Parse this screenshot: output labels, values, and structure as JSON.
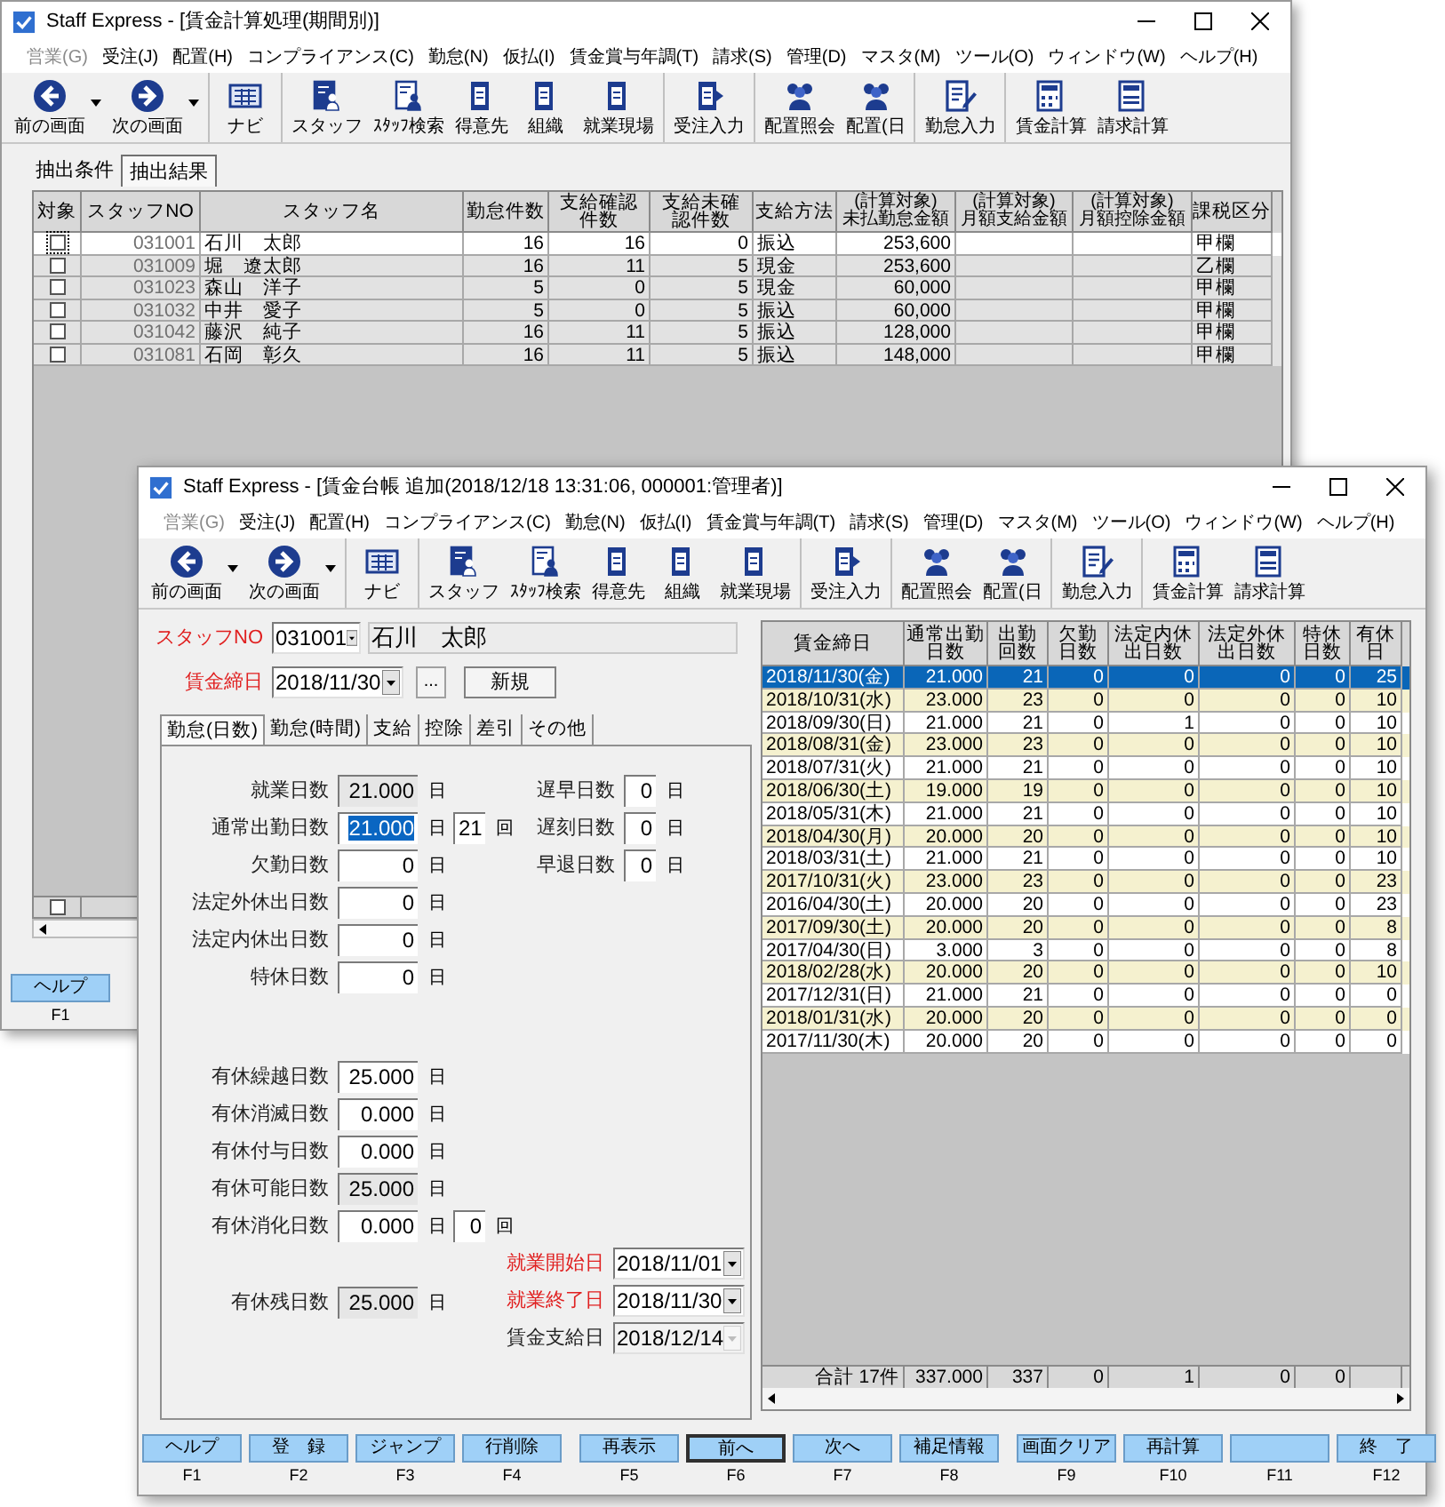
{
  "back_window": {
    "title": "Staff Express - [賃金計算処理(期間別)]",
    "menu": [
      {
        "label": "営業(G)",
        "disabled": true
      },
      {
        "label": "受注(J)",
        "disabled": false
      },
      {
        "label": "配置(H)",
        "disabled": false
      },
      {
        "label": "コンプライアンス(C)",
        "disabled": false
      },
      {
        "label": "勤怠(N)",
        "disabled": false
      },
      {
        "label": "仮払(I)",
        "disabled": false
      },
      {
        "label": "賃金賞与年調(T)",
        "disabled": false
      },
      {
        "label": "請求(S)",
        "disabled": false
      },
      {
        "label": "管理(D)",
        "disabled": false
      },
      {
        "label": "マスタ(M)",
        "disabled": false
      },
      {
        "label": "ツール(O)",
        "disabled": false
      },
      {
        "label": "ウィンドウ(W)",
        "disabled": false
      },
      {
        "label": "ヘルプ(H)",
        "disabled": false
      }
    ],
    "toolbar": [
      [
        {
          "label": "前の画面",
          "kind": "back",
          "dropdown": true
        },
        {
          "label": "次の画面",
          "kind": "forward",
          "dropdown": true
        }
      ],
      [
        {
          "label": "ナビ",
          "kind": "panel",
          "dropdown": false
        }
      ],
      [
        {
          "label": "スタッフ",
          "kind": "staff",
          "dropdown": false
        },
        {
          "label": "ｽﾀｯﾌ検索",
          "kind": "search",
          "dropdown": false
        },
        {
          "label": "得意先",
          "kind": "doc",
          "dropdown": false
        },
        {
          "label": "組織",
          "kind": "doc",
          "dropdown": false
        },
        {
          "label": "就業現場",
          "kind": "doc",
          "dropdown": false
        }
      ],
      [
        {
          "label": "受注入力",
          "kind": "doc-arrow",
          "dropdown": false
        }
      ],
      [
        {
          "label": "配置照会",
          "kind": "people",
          "dropdown": false
        },
        {
          "label": "配置(日",
          "kind": "people",
          "dropdown": false
        }
      ],
      [
        {
          "label": "勤怠入力",
          "kind": "pen",
          "dropdown": false
        }
      ],
      [
        {
          "label": "賃金計算",
          "kind": "calc",
          "dropdown": false
        },
        {
          "label": "請求計算",
          "kind": "calc-doc",
          "dropdown": false
        }
      ]
    ],
    "tabs": [
      {
        "label": "抽出条件",
        "selected": false
      },
      {
        "label": "抽出結果",
        "selected": true
      }
    ],
    "table": {
      "columns": [
        "対象",
        "スタッフNO",
        "スタッフ名",
        "勤怠件数",
        "支給確認件数",
        "支給未確認件数",
        "支給方法",
        "(計算対象)未払勤怠金額",
        "(計算対象)月額支給金額",
        "(計算対象)月額控除金額",
        "課税区分"
      ],
      "rows": [
        {
          "checked": false,
          "selected": true,
          "cells": [
            "",
            "031001",
            "石川　太郎",
            "16",
            "16",
            "0",
            "振込",
            "253,600",
            "",
            "",
            "甲欄"
          ]
        },
        {
          "checked": false,
          "selected": false,
          "cells": [
            "",
            "031009",
            "堀　遼太郎",
            "16",
            "11",
            "5",
            "現金",
            "253,600",
            "",
            "",
            "乙欄"
          ]
        },
        {
          "checked": false,
          "selected": false,
          "cells": [
            "",
            "031023",
            "森山　洋子",
            "5",
            "0",
            "5",
            "現金",
            "60,000",
            "",
            "",
            "甲欄"
          ]
        },
        {
          "checked": false,
          "selected": false,
          "cells": [
            "",
            "031032",
            "中井　愛子",
            "5",
            "0",
            "5",
            "振込",
            "60,000",
            "",
            "",
            "甲欄"
          ]
        },
        {
          "checked": false,
          "selected": false,
          "cells": [
            "",
            "031042",
            "藤沢　純子",
            "16",
            "11",
            "5",
            "振込",
            "128,000",
            "",
            "",
            "甲欄"
          ]
        },
        {
          "checked": false,
          "selected": false,
          "cells": [
            "",
            "031081",
            "石岡　彰久",
            "16",
            "11",
            "5",
            "振込",
            "148,000",
            "",
            "",
            "甲欄"
          ]
        }
      ],
      "new_row": {
        "checked": false
      }
    },
    "function_keys": [
      {
        "label": "ヘルプ",
        "key": "F1"
      }
    ]
  },
  "front_window": {
    "title": "Staff Express - [賃金台帳 追加(2018/12/18 13:31:06, 000001:管理者)]",
    "menu": [
      {
        "label": "営業(G)",
        "disabled": true
      },
      {
        "label": "受注(J)",
        "disabled": false
      },
      {
        "label": "配置(H)",
        "disabled": false
      },
      {
        "label": "コンプライアンス(C)",
        "disabled": false
      },
      {
        "label": "勤怠(N)",
        "disabled": false
      },
      {
        "label": "仮払(I)",
        "disabled": false
      },
      {
        "label": "賃金賞与年調(T)",
        "disabled": false
      },
      {
        "label": "請求(S)",
        "disabled": false
      },
      {
        "label": "管理(D)",
        "disabled": false
      },
      {
        "label": "マスタ(M)",
        "disabled": false
      },
      {
        "label": "ツール(O)",
        "disabled": false
      },
      {
        "label": "ウィンドウ(W)",
        "disabled": false
      },
      {
        "label": "ヘルプ(H)",
        "disabled": false
      }
    ],
    "toolbar": [
      [
        {
          "label": "前の画面",
          "kind": "back",
          "dropdown": true
        },
        {
          "label": "次の画面",
          "kind": "forward",
          "dropdown": true
        }
      ],
      [
        {
          "label": "ナビ",
          "kind": "panel",
          "dropdown": false
        }
      ],
      [
        {
          "label": "スタッフ",
          "kind": "staff",
          "dropdown": false
        },
        {
          "label": "ｽﾀｯﾌ検索",
          "kind": "search",
          "dropdown": false
        },
        {
          "label": "得意先",
          "kind": "doc",
          "dropdown": false
        },
        {
          "label": "組織",
          "kind": "doc",
          "dropdown": false
        },
        {
          "label": "就業現場",
          "kind": "doc",
          "dropdown": false
        }
      ],
      [
        {
          "label": "受注入力",
          "kind": "doc-arrow",
          "dropdown": false
        }
      ],
      [
        {
          "label": "配置照会",
          "kind": "people",
          "dropdown": false
        },
        {
          "label": "配置(日",
          "kind": "people",
          "dropdown": false
        }
      ],
      [
        {
          "label": "勤怠入力",
          "kind": "pen",
          "dropdown": false
        }
      ],
      [
        {
          "label": "賃金計算",
          "kind": "calc",
          "dropdown": false
        },
        {
          "label": "請求計算",
          "kind": "calc-doc",
          "dropdown": false
        }
      ]
    ],
    "staff": {
      "label": "スタッフNO",
      "required": true,
      "value": "031001",
      "name": "石川　太郎"
    },
    "pay_close": {
      "label": "賃金締日",
      "required": true,
      "value": "2018/11/30",
      "browse": "...",
      "new_button": "新規"
    },
    "tabs": [
      {
        "label": "勤怠(日数)",
        "selected": true
      },
      {
        "label": "勤怠(時間)",
        "selected": false
      },
      {
        "label": "支給",
        "selected": false
      },
      {
        "label": "控除",
        "selected": false
      },
      {
        "label": "差引",
        "selected": false
      },
      {
        "label": "その他",
        "selected": false
      }
    ],
    "attendance_fields": [
      {
        "label": "就業日数",
        "value": "21.000",
        "unit": "日",
        "readonly": true,
        "highlighted": false
      },
      {
        "label": "通常出勤日数",
        "value": "21.000",
        "unit": "日",
        "readonly": false,
        "highlighted": true,
        "count": "21",
        "count_unit": "回"
      },
      {
        "label": "欠勤日数",
        "value": "0",
        "unit": "日",
        "readonly": false,
        "highlighted": false
      },
      {
        "label": "法定外休出日数",
        "value": "0",
        "unit": "日",
        "readonly": false,
        "highlighted": false
      },
      {
        "label": "法定内休出日数",
        "value": "0",
        "unit": "日",
        "readonly": false,
        "highlighted": false
      },
      {
        "label": "特休日数",
        "value": "0",
        "unit": "日",
        "readonly": false,
        "highlighted": false
      }
    ],
    "late_fields": [
      {
        "label": "遅早日数",
        "value": "0",
        "unit": "日"
      },
      {
        "label": "遅刻日数",
        "value": "0",
        "unit": "日"
      },
      {
        "label": "早退日数",
        "value": "0",
        "unit": "日"
      }
    ],
    "leave_fields": [
      {
        "label": "有休繰越日数",
        "value": "25.000",
        "unit": "日",
        "readonly": false
      },
      {
        "label": "有休消滅日数",
        "value": "0.000",
        "unit": "日",
        "readonly": false
      },
      {
        "label": "有休付与日数",
        "value": "0.000",
        "unit": "日",
        "readonly": false
      },
      {
        "label": "有休可能日数",
        "value": "25.000",
        "unit": "日",
        "readonly": true
      },
      {
        "label": "有休消化日数",
        "value": "0.000",
        "unit": "日",
        "readonly": false,
        "count": "0",
        "count_unit": "回"
      }
    ],
    "remaining_leave": {
      "label": "有休残日数",
      "value": "25.000",
      "unit": "日",
      "readonly": true
    },
    "date_fields": [
      {
        "label": "就業開始日",
        "required": true,
        "value": "2018/11/01",
        "disabled": false
      },
      {
        "label": "就業終了日",
        "required": true,
        "value": "2018/11/30",
        "disabled": false
      },
      {
        "label": "賃金支給日",
        "required": false,
        "value": "2018/12/14",
        "disabled": true
      }
    ],
    "table": {
      "columns": [
        "賃金締日",
        "通常出勤日数",
        "出勤回数",
        "欠勤日数",
        "法定内休出日数",
        "法定外休出日数",
        "特休日数",
        "有休日"
      ],
      "rows": [
        {
          "selected": true,
          "cells": [
            "2018/11/30(金)",
            "21.000",
            "21",
            "0",
            "0",
            "0",
            "0",
            "25"
          ]
        },
        {
          "selected": false,
          "cells": [
            "2018/10/31(水)",
            "23.000",
            "23",
            "0",
            "0",
            "0",
            "0",
            "10"
          ]
        },
        {
          "selected": false,
          "cells": [
            "2018/09/30(日)",
            "21.000",
            "21",
            "0",
            "1",
            "0",
            "0",
            "10"
          ]
        },
        {
          "selected": false,
          "cells": [
            "2018/08/31(金)",
            "23.000",
            "23",
            "0",
            "0",
            "0",
            "0",
            "10"
          ]
        },
        {
          "selected": false,
          "cells": [
            "2018/07/31(火)",
            "21.000",
            "21",
            "0",
            "0",
            "0",
            "0",
            "10"
          ]
        },
        {
          "selected": false,
          "cells": [
            "2018/06/30(土)",
            "19.000",
            "19",
            "0",
            "0",
            "0",
            "0",
            "10"
          ]
        },
        {
          "selected": false,
          "cells": [
            "2018/05/31(木)",
            "21.000",
            "21",
            "0",
            "0",
            "0",
            "0",
            "10"
          ]
        },
        {
          "selected": false,
          "cells": [
            "2018/04/30(月)",
            "20.000",
            "20",
            "0",
            "0",
            "0",
            "0",
            "10"
          ]
        },
        {
          "selected": false,
          "cells": [
            "2018/03/31(土)",
            "21.000",
            "21",
            "0",
            "0",
            "0",
            "0",
            "10"
          ]
        },
        {
          "selected": false,
          "cells": [
            "2017/10/31(火)",
            "23.000",
            "23",
            "0",
            "0",
            "0",
            "0",
            "23"
          ]
        },
        {
          "selected": false,
          "cells": [
            "2016/04/30(土)",
            "20.000",
            "20",
            "0",
            "0",
            "0",
            "0",
            "23"
          ]
        },
        {
          "selected": false,
          "cells": [
            "2017/09/30(土)",
            "20.000",
            "20",
            "0",
            "0",
            "0",
            "0",
            "8"
          ]
        },
        {
          "selected": false,
          "cells": [
            "2017/04/30(日)",
            "3.000",
            "3",
            "0",
            "0",
            "0",
            "0",
            "8"
          ]
        },
        {
          "selected": false,
          "cells": [
            "2018/02/28(水)",
            "20.000",
            "20",
            "0",
            "0",
            "0",
            "0",
            "10"
          ]
        },
        {
          "selected": false,
          "cells": [
            "2017/12/31(日)",
            "21.000",
            "21",
            "0",
            "0",
            "0",
            "0",
            "0"
          ]
        },
        {
          "selected": false,
          "cells": [
            "2018/01/31(水)",
            "20.000",
            "20",
            "0",
            "0",
            "0",
            "0",
            "0"
          ]
        },
        {
          "selected": false,
          "cells": [
            "2017/11/30(木)",
            "20.000",
            "20",
            "0",
            "0",
            "0",
            "0",
            "0"
          ]
        }
      ],
      "totals": [
        "合計 17件",
        "337.000",
        "337",
        "0",
        "1",
        "0",
        "0"
      ]
    },
    "function_keys": [
      [
        {
          "label": "ヘルプ",
          "key": "F1",
          "focused": false
        },
        {
          "label": "登　録",
          "key": "F2",
          "focused": false
        },
        {
          "label": "ジャンプ",
          "key": "F3",
          "focused": false
        },
        {
          "label": "行削除",
          "key": "F4",
          "focused": false
        }
      ],
      [
        {
          "label": "再表示",
          "key": "F5",
          "focused": false
        },
        {
          "label": "前へ",
          "key": "F6",
          "focused": true
        },
        {
          "label": "次へ",
          "key": "F7",
          "focused": false
        },
        {
          "label": "補足情報",
          "key": "F8",
          "focused": false
        }
      ],
      [
        {
          "label": "画面クリア",
          "key": "F9",
          "focused": false
        },
        {
          "label": "再計算",
          "key": "F10",
          "focused": false
        },
        {
          "key": "F11",
          "focused": false
        },
        {
          "label": "終　了",
          "key": "F12",
          "focused": false
        }
      ]
    ]
  }
}
